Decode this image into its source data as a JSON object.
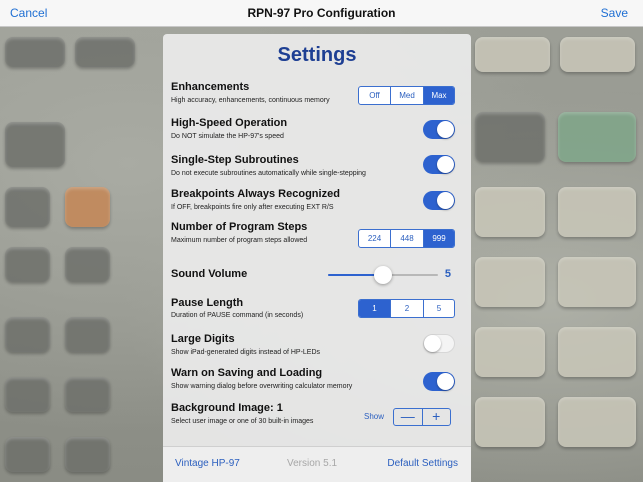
{
  "navbar": {
    "cancel_label": "Cancel",
    "title": "RPN-97 Pro Configuration",
    "save_label": "Save"
  },
  "panel": {
    "title": "Settings"
  },
  "enhancements": {
    "title": "Enhancements",
    "subtitle": "High accuracy, enhancements, continuous memory",
    "options": [
      "Off",
      "Med",
      "Max"
    ],
    "selected": "Max"
  },
  "high_speed": {
    "title": "High-Speed Operation",
    "subtitle": "Do NOT simulate the HP-97's speed",
    "on": true
  },
  "single_step": {
    "title": "Single-Step Subroutines",
    "subtitle": "Do not execute subroutines automatically while single-stepping",
    "on": true
  },
  "breakpoints": {
    "title": "Breakpoints Always Recognized",
    "subtitle": "If OFF, breakpoints fire only after executing EXT R/S",
    "on": true
  },
  "program_steps": {
    "title": "Number of Program Steps",
    "subtitle": "Maximum number of program steps allowed",
    "options": [
      "224",
      "448",
      "999"
    ],
    "selected": "999"
  },
  "sound_volume": {
    "title": "Sound Volume",
    "value": "5",
    "level_fraction": 0.5
  },
  "pause_length": {
    "title": "Pause Length",
    "subtitle": "Duration of PAUSE command (in seconds)",
    "options": [
      "1",
      "2",
      "5"
    ],
    "selected": "1"
  },
  "large_digits": {
    "title": "Large Digits",
    "subtitle": "Show iPad-generated digits instead of HP-LEDs",
    "on": false
  },
  "warn_saving": {
    "title": "Warn on Saving and Loading",
    "subtitle": "Show warning dialog before overwriting calculator memory",
    "on": true
  },
  "background_image": {
    "title": "Background Image: 1",
    "subtitle": "Select user image or one of 30 built-in images",
    "show_label": "Show",
    "minus": "—",
    "plus": "+"
  },
  "footer": {
    "vintage_label": "Vintage HP-97",
    "version_label": "Version 5.1",
    "default_label": "Default Settings"
  },
  "colors": {
    "accent": "#2d62cf",
    "title_blue": "#1e3f93"
  }
}
